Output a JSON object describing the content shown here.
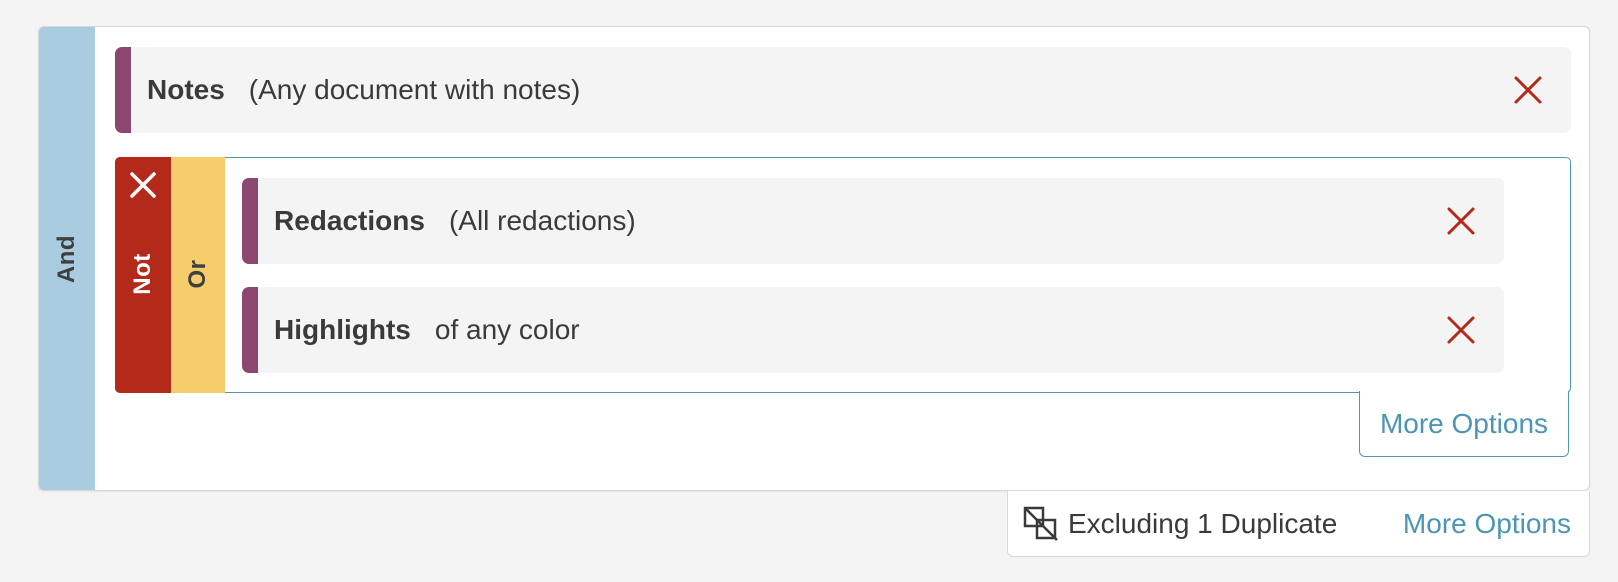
{
  "colors": {
    "and_bar": "#a9cce0",
    "not_bar": "#b32a1b",
    "or_bar": "#f6cd6b",
    "condition_accent": "#8c4770",
    "remove_x": "#b32a1b",
    "link": "#4d95b5",
    "group_border": "#4f96b3"
  },
  "query": {
    "and_label": "And",
    "notes_condition": {
      "field": "Notes",
      "description": "(Any document with notes)",
      "remove_icon": "close-icon"
    },
    "not_group": {
      "not_label": "Not",
      "or_label": "Or",
      "close_icon": "close-icon",
      "conditions": [
        {
          "field": "Redactions",
          "description": "(All redactions)",
          "remove_icon": "close-icon"
        },
        {
          "field": "Highlights",
          "description": "of any color",
          "remove_icon": "close-icon"
        }
      ],
      "more_options_label": "More Options"
    }
  },
  "footer": {
    "duplicate_icon": "exclude-duplicates-icon",
    "duplicate_text": "Excluding 1 Duplicate",
    "more_options_label": "More Options"
  }
}
